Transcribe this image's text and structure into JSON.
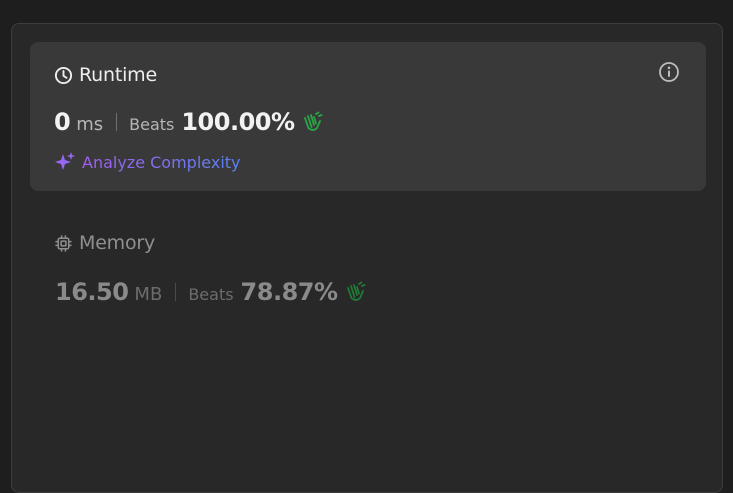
{
  "runtime": {
    "title": "Runtime",
    "value": "0",
    "unit": "ms",
    "beats_label": "Beats",
    "beats_value": "100.00%",
    "analyze_label": "Analyze Complexity"
  },
  "memory": {
    "title": "Memory",
    "value": "16.50",
    "unit": "MB",
    "beats_label": "Beats",
    "beats_value": "78.87%"
  },
  "icons": {
    "runtime": "clock-icon",
    "info": "info-icon",
    "analyze": "sparkle-icon",
    "memory": "chip-icon",
    "clap": "clapping-hands-icon"
  },
  "colors": {
    "clap_active": "#27a844",
    "clap_muted": "#1f7a36",
    "analyze_gradient_start": "#a25ff0",
    "analyze_gradient_end": "#5a82f3"
  }
}
